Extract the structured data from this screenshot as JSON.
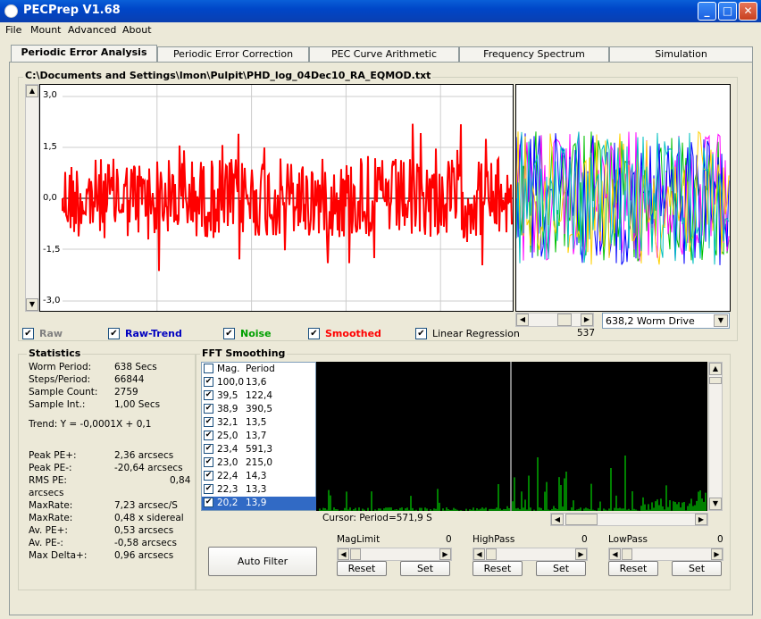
{
  "window": {
    "title": "PECPrep V1.68",
    "controls": [
      "_",
      "□",
      "✕"
    ]
  },
  "menu": [
    "File",
    "Mount",
    "Advanced",
    "About"
  ],
  "tabs": [
    "Periodic Error Analysis",
    "Periodic Error Correction",
    "PEC Curve Arithmetic",
    "Frequency Spectrum",
    "Simulation"
  ],
  "file_path": "C:\\Documents and Settings\\lmon\\Pulpit\\PHD_log_04Dec10_RA_EQMOD.txt",
  "plot": {
    "y_ticks": [
      "3,0",
      "1,5",
      "0,0",
      "-1,5",
      "-3,0"
    ],
    "colors": {
      "trace": "#FF0000",
      "multi": [
        "#00C000",
        "#FF00FF",
        "#0000FF",
        "#FFD000",
        "#00C0C0"
      ]
    }
  },
  "worm": {
    "scroll_value": "537",
    "dropdown": "638,2 Worm Drive"
  },
  "checks": [
    {
      "label": "Raw",
      "checked": true,
      "color": "#808080"
    },
    {
      "label": "Raw-Trend",
      "checked": true,
      "color": "#0000C0"
    },
    {
      "label": "Noise",
      "checked": true,
      "color": "#00A000"
    },
    {
      "label": "Smoothed",
      "checked": true,
      "color": "#FF0000"
    },
    {
      "label": "Linear Regression",
      "checked": true,
      "color": "#000000"
    }
  ],
  "statistics": {
    "title": "Statistics",
    "rows": [
      {
        "k": "Worm Period:",
        "v": "638 Secs"
      },
      {
        "k": "Steps/Period:",
        "v": "66844"
      },
      {
        "k": "Sample Count:",
        "v": "2759"
      },
      {
        "k": "Sample Int.:",
        "v": "1,00 Secs"
      }
    ],
    "trend": "Trend: Y = -0,0001X + 0,1",
    "rows2": [
      {
        "k": "Peak PE+:",
        "v": "2,36 arcsecs"
      },
      {
        "k": "Peak PE-:",
        "v": "-20,64 arcsecs"
      },
      {
        "k": "RMS PE:",
        "v": "0,84"
      },
      {
        "k": "arcsecs",
        "v": ""
      },
      {
        "k": "MaxRate:",
        "v": "7,23 arcsec/S"
      },
      {
        "k": "MaxRate:",
        "v": "0,48 x sidereal"
      },
      {
        "k": "Av. PE+:",
        "v": "0,53 arcsecs"
      },
      {
        "k": "Av. PE-:",
        "v": "-0,58 arcsecs"
      },
      {
        "k": "Max Delta+:",
        "v": "0,96 arcsecs"
      }
    ]
  },
  "fft": {
    "title": "FFT Smoothing",
    "header": {
      "mag": "Mag.",
      "period": "Period"
    },
    "rows": [
      {
        "mag": "100,0",
        "period": "13,6"
      },
      {
        "mag": "39,5",
        "period": "122,4"
      },
      {
        "mag": "38,9",
        "period": "390,5"
      },
      {
        "mag": "32,1",
        "period": "13,5"
      },
      {
        "mag": "25,0",
        "period": "13,7"
      },
      {
        "mag": "23,4",
        "period": "591,3"
      },
      {
        "mag": "23,0",
        "period": "215,0"
      },
      {
        "mag": "22,4",
        "period": "14,3"
      },
      {
        "mag": "22,3",
        "period": "13,3"
      },
      {
        "mag": "20,2",
        "period": "13,9"
      }
    ],
    "cursor": "Cursor: Period=571,9 S"
  },
  "filters": {
    "auto": "Auto Filter",
    "groups": [
      {
        "label": "MagLimit",
        "value": "0",
        "reset": "Reset",
        "set": "Set"
      },
      {
        "label": "HighPass",
        "value": "0",
        "reset": "Reset",
        "set": "Set"
      },
      {
        "label": "LowPass",
        "value": "0",
        "reset": "Reset",
        "set": "Set"
      }
    ]
  }
}
